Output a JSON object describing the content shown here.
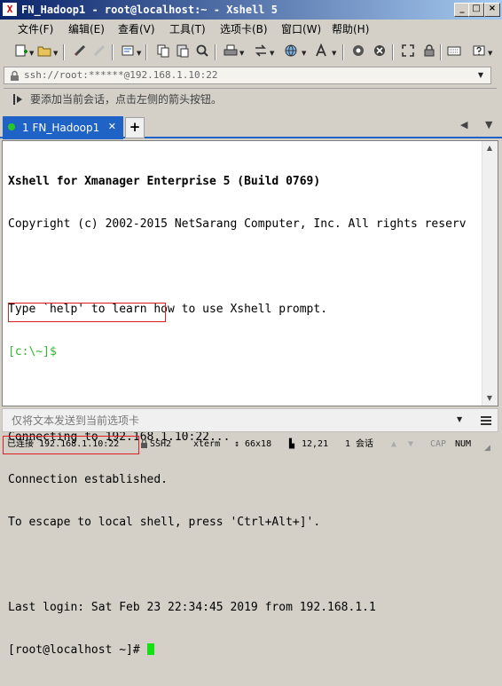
{
  "window": {
    "title": "FN_Hadoop1 - root@localhost:~ - Xshell 5",
    "app_icon_glyph": "X",
    "controls": {
      "minimize": "_",
      "maximize": "□",
      "close": "×"
    }
  },
  "menu": {
    "items": [
      "文件(F)",
      "编辑(E)",
      "查看(V)",
      "工具(T)",
      "选项卡(B)",
      "窗口(W)",
      "帮助(H)"
    ]
  },
  "toolbar": {
    "icons": [
      "new-session-icon",
      "open-folder-icon",
      "disconnect-icon",
      "reconnect-icon",
      "properties-icon",
      "copy-icon",
      "paste-icon",
      "find-icon",
      "print-icon",
      "transfer-icon",
      "globe-icon",
      "font-icon",
      "xftp-icon",
      "xmanager-icon",
      "fullscreen-icon",
      "lock-icon",
      "keyboard-icon",
      "help-icon"
    ]
  },
  "address": {
    "value": "ssh://root:******@192.168.1.10:22"
  },
  "hint": {
    "text": "要添加当前会话，点击左侧的箭头按钮。"
  },
  "tabs": {
    "items": [
      {
        "label": "1 FN_Hadoop1",
        "active": true
      }
    ],
    "add_label": "+"
  },
  "terminal": {
    "lines": [
      {
        "text": "Xshell for Xmanager Enterprise 5 (Build 0769)",
        "bold": true
      },
      {
        "text": "Copyright (c) 2002-2015 NetSarang Computer, Inc. All rights reserv"
      },
      {
        "text": ""
      },
      {
        "text": "Type `help' to learn how to use Xshell prompt."
      },
      {
        "text": "[c:\\~]$",
        "color": "green"
      },
      {
        "text": ""
      },
      {
        "text": "Connecting to 192.168.1.10:22..."
      },
      {
        "text": "Connection established."
      },
      {
        "text": "To escape to local shell, press 'Ctrl+Alt+]'."
      },
      {
        "text": ""
      },
      {
        "text": "Last login: Sat Feb 23 22:34:45 2019 from 192.168.1.1"
      }
    ],
    "prompt": "[root@localhost ~]# "
  },
  "compose": {
    "placeholder": "仅将文本发送到当前选项卡"
  },
  "status": {
    "connection": "已连接 192.168.1.10:22",
    "protocol": "SSH2",
    "terminal_type": "xterm",
    "size": "66x18",
    "cursor_pos": "12,21",
    "sessions": "1 会话",
    "caps": "CAP",
    "num": "NUM"
  },
  "colors": {
    "tab_active": "#1f63c6",
    "prompt_green": "#2fba2f",
    "cursor_green": "#14e014",
    "highlight_red": "#e02020"
  }
}
